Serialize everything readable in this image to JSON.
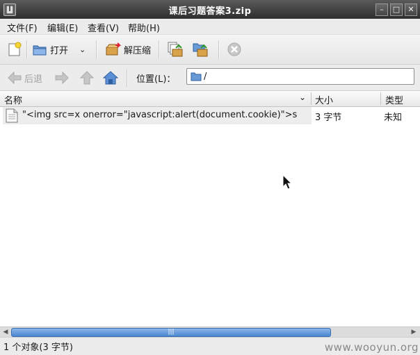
{
  "window": {
    "title": "课后习题答案3.zip"
  },
  "menu": [
    "文件(F)",
    "编辑(E)",
    "查看(V)",
    "帮助(H)"
  ],
  "toolbar": {
    "open_label": "打开",
    "extract_label": "解压缩"
  },
  "location": {
    "back_label": "后退",
    "label": "位置(L)：",
    "path": "/"
  },
  "columns": {
    "name": "名称",
    "size": "大小",
    "type": "类型"
  },
  "files": [
    {
      "name": "\"<img src=x onerror=\"javascript:alert(document.cookie)\">s",
      "size": "3 字节",
      "type": "未知"
    }
  ],
  "status": "1 个对象(3 字节)",
  "watermark": "www.wooyun.org",
  "icons": {
    "app": "archive-icon",
    "minimize": "minimize-icon",
    "maximize": "maximize-icon",
    "close": "close-icon",
    "new": "new-archive-icon",
    "open": "open-folder-icon",
    "extract": "extract-icon",
    "add_files": "add-files-icon",
    "add_folder": "add-folder-icon",
    "stop": "stop-icon",
    "back": "back-arrow-icon",
    "forward": "forward-arrow-icon",
    "up": "up-arrow-icon",
    "home": "home-icon",
    "folder": "folder-icon",
    "file": "file-icon",
    "sort": "chevron-down-icon"
  },
  "colors": {
    "accent": "#4a86d0",
    "titlebar": "#3a3a3a"
  }
}
